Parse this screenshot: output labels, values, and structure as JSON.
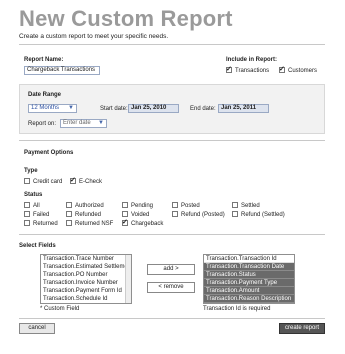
{
  "page": {
    "title": "New Custom Report",
    "subtitle": "Create a custom report to meet your specific needs."
  },
  "report": {
    "name_label": "Report Name:",
    "name_value": "Chargeback Transactions",
    "include_label": "Include in Report:",
    "include_transactions": {
      "label": "Transactions",
      "checked": true
    },
    "include_customers": {
      "label": "Customers",
      "checked": true
    }
  },
  "date_range": {
    "heading": "Date Range",
    "preset_value": "12 Months",
    "start_label": "Start date:",
    "start_value": "Jan 25, 2010",
    "end_label": "End date:",
    "end_value": "Jan 25, 2011",
    "report_on_label": "Report on:",
    "report_on_value": "Enter date"
  },
  "payment": {
    "heading": "Payment Options",
    "type_heading": "Type",
    "types": [
      {
        "label": "Credit card",
        "checked": false
      },
      {
        "label": "E-Check",
        "checked": true
      }
    ],
    "status_heading": "Status",
    "statuses": [
      {
        "label": "All",
        "checked": false
      },
      {
        "label": "Authorized",
        "checked": false
      },
      {
        "label": "Pending",
        "checked": false
      },
      {
        "label": "Posted",
        "checked": false
      },
      {
        "label": "Settled",
        "checked": false
      },
      {
        "label": "Failed",
        "checked": false
      },
      {
        "label": "Refunded",
        "checked": false
      },
      {
        "label": "Voided",
        "checked": false
      },
      {
        "label": "Refund (Posted)",
        "checked": false
      },
      {
        "label": "Refund (Settled)",
        "checked": false
      },
      {
        "label": "Returned",
        "checked": false
      },
      {
        "label": "Returned NSF",
        "checked": false
      },
      {
        "label": "Chargeback",
        "checked": true
      }
    ]
  },
  "fields": {
    "heading": "Select Fields",
    "available": [
      "Transaction.Trace Number",
      "Transaction.Estimated Settlement",
      "Transaction.PO Number",
      "Transaction.Invoice Number",
      "Transaction.Payment Form Id",
      "Transaction.Schedule Id"
    ],
    "selected": [
      "Transaction.Transaction Id",
      "Transaction.Transaction Date",
      "Transaction.Status",
      "Transaction.Payment Type",
      "Transaction.Amount",
      "Transaction.Reason Description"
    ],
    "add_label": "add >",
    "remove_label": "< remove",
    "custom_note": "* Custom Field",
    "required_note": "Transaction Id is required"
  },
  "actions": {
    "cancel_label": "cancel",
    "create_label": "create report"
  }
}
